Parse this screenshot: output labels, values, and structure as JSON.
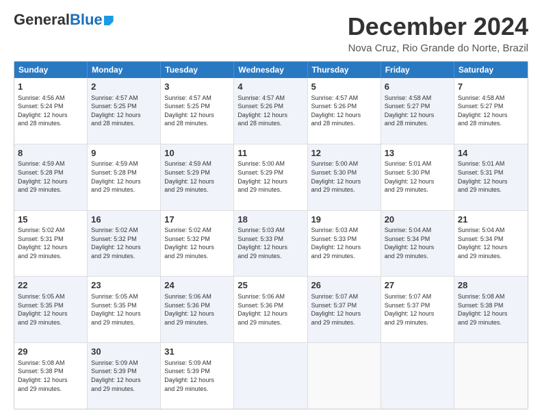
{
  "logo": {
    "general": "General",
    "blue": "Blue"
  },
  "title": "December 2024",
  "subtitle": "Nova Cruz, Rio Grande do Norte, Brazil",
  "header_days": [
    "Sunday",
    "Monday",
    "Tuesday",
    "Wednesday",
    "Thursday",
    "Friday",
    "Saturday"
  ],
  "rows": [
    [
      {
        "num": "1",
        "text": "Sunrise: 4:56 AM\nSunset: 5:24 PM\nDaylight: 12 hours\nand 28 minutes.",
        "alt": false
      },
      {
        "num": "2",
        "text": "Sunrise: 4:57 AM\nSunset: 5:25 PM\nDaylight: 12 hours\nand 28 minutes.",
        "alt": true
      },
      {
        "num": "3",
        "text": "Sunrise: 4:57 AM\nSunset: 5:25 PM\nDaylight: 12 hours\nand 28 minutes.",
        "alt": false
      },
      {
        "num": "4",
        "text": "Sunrise: 4:57 AM\nSunset: 5:26 PM\nDaylight: 12 hours\nand 28 minutes.",
        "alt": true
      },
      {
        "num": "5",
        "text": "Sunrise: 4:57 AM\nSunset: 5:26 PM\nDaylight: 12 hours\nand 28 minutes.",
        "alt": false
      },
      {
        "num": "6",
        "text": "Sunrise: 4:58 AM\nSunset: 5:27 PM\nDaylight: 12 hours\nand 28 minutes.",
        "alt": true
      },
      {
        "num": "7",
        "text": "Sunrise: 4:58 AM\nSunset: 5:27 PM\nDaylight: 12 hours\nand 28 minutes.",
        "alt": false
      }
    ],
    [
      {
        "num": "8",
        "text": "Sunrise: 4:59 AM\nSunset: 5:28 PM\nDaylight: 12 hours\nand 29 minutes.",
        "alt": true
      },
      {
        "num": "9",
        "text": "Sunrise: 4:59 AM\nSunset: 5:28 PM\nDaylight: 12 hours\nand 29 minutes.",
        "alt": false
      },
      {
        "num": "10",
        "text": "Sunrise: 4:59 AM\nSunset: 5:29 PM\nDaylight: 12 hours\nand 29 minutes.",
        "alt": true
      },
      {
        "num": "11",
        "text": "Sunrise: 5:00 AM\nSunset: 5:29 PM\nDaylight: 12 hours\nand 29 minutes.",
        "alt": false
      },
      {
        "num": "12",
        "text": "Sunrise: 5:00 AM\nSunset: 5:30 PM\nDaylight: 12 hours\nand 29 minutes.",
        "alt": true
      },
      {
        "num": "13",
        "text": "Sunrise: 5:01 AM\nSunset: 5:30 PM\nDaylight: 12 hours\nand 29 minutes.",
        "alt": false
      },
      {
        "num": "14",
        "text": "Sunrise: 5:01 AM\nSunset: 5:31 PM\nDaylight: 12 hours\nand 29 minutes.",
        "alt": true
      }
    ],
    [
      {
        "num": "15",
        "text": "Sunrise: 5:02 AM\nSunset: 5:31 PM\nDaylight: 12 hours\nand 29 minutes.",
        "alt": false
      },
      {
        "num": "16",
        "text": "Sunrise: 5:02 AM\nSunset: 5:32 PM\nDaylight: 12 hours\nand 29 minutes.",
        "alt": true
      },
      {
        "num": "17",
        "text": "Sunrise: 5:02 AM\nSunset: 5:32 PM\nDaylight: 12 hours\nand 29 minutes.",
        "alt": false
      },
      {
        "num": "18",
        "text": "Sunrise: 5:03 AM\nSunset: 5:33 PM\nDaylight: 12 hours\nand 29 minutes.",
        "alt": true
      },
      {
        "num": "19",
        "text": "Sunrise: 5:03 AM\nSunset: 5:33 PM\nDaylight: 12 hours\nand 29 minutes.",
        "alt": false
      },
      {
        "num": "20",
        "text": "Sunrise: 5:04 AM\nSunset: 5:34 PM\nDaylight: 12 hours\nand 29 minutes.",
        "alt": true
      },
      {
        "num": "21",
        "text": "Sunrise: 5:04 AM\nSunset: 5:34 PM\nDaylight: 12 hours\nand 29 minutes.",
        "alt": false
      }
    ],
    [
      {
        "num": "22",
        "text": "Sunrise: 5:05 AM\nSunset: 5:35 PM\nDaylight: 12 hours\nand 29 minutes.",
        "alt": true
      },
      {
        "num": "23",
        "text": "Sunrise: 5:05 AM\nSunset: 5:35 PM\nDaylight: 12 hours\nand 29 minutes.",
        "alt": false
      },
      {
        "num": "24",
        "text": "Sunrise: 5:06 AM\nSunset: 5:36 PM\nDaylight: 12 hours\nand 29 minutes.",
        "alt": true
      },
      {
        "num": "25",
        "text": "Sunrise: 5:06 AM\nSunset: 5:36 PM\nDaylight: 12 hours\nand 29 minutes.",
        "alt": false
      },
      {
        "num": "26",
        "text": "Sunrise: 5:07 AM\nSunset: 5:37 PM\nDaylight: 12 hours\nand 29 minutes.",
        "alt": true
      },
      {
        "num": "27",
        "text": "Sunrise: 5:07 AM\nSunset: 5:37 PM\nDaylight: 12 hours\nand 29 minutes.",
        "alt": false
      },
      {
        "num": "28",
        "text": "Sunrise: 5:08 AM\nSunset: 5:38 PM\nDaylight: 12 hours\nand 29 minutes.",
        "alt": true
      }
    ],
    [
      {
        "num": "29",
        "text": "Sunrise: 5:08 AM\nSunset: 5:38 PM\nDaylight: 12 hours\nand 29 minutes.",
        "alt": false
      },
      {
        "num": "30",
        "text": "Sunrise: 5:09 AM\nSunset: 5:39 PM\nDaylight: 12 hours\nand 29 minutes.",
        "alt": true
      },
      {
        "num": "31",
        "text": "Sunrise: 5:09 AM\nSunset: 5:39 PM\nDaylight: 12 hours\nand 29 minutes.",
        "alt": false
      },
      {
        "num": "",
        "text": "",
        "alt": true,
        "empty": true
      },
      {
        "num": "",
        "text": "",
        "alt": false,
        "empty": true
      },
      {
        "num": "",
        "text": "",
        "alt": true,
        "empty": true
      },
      {
        "num": "",
        "text": "",
        "alt": false,
        "empty": true
      }
    ]
  ]
}
